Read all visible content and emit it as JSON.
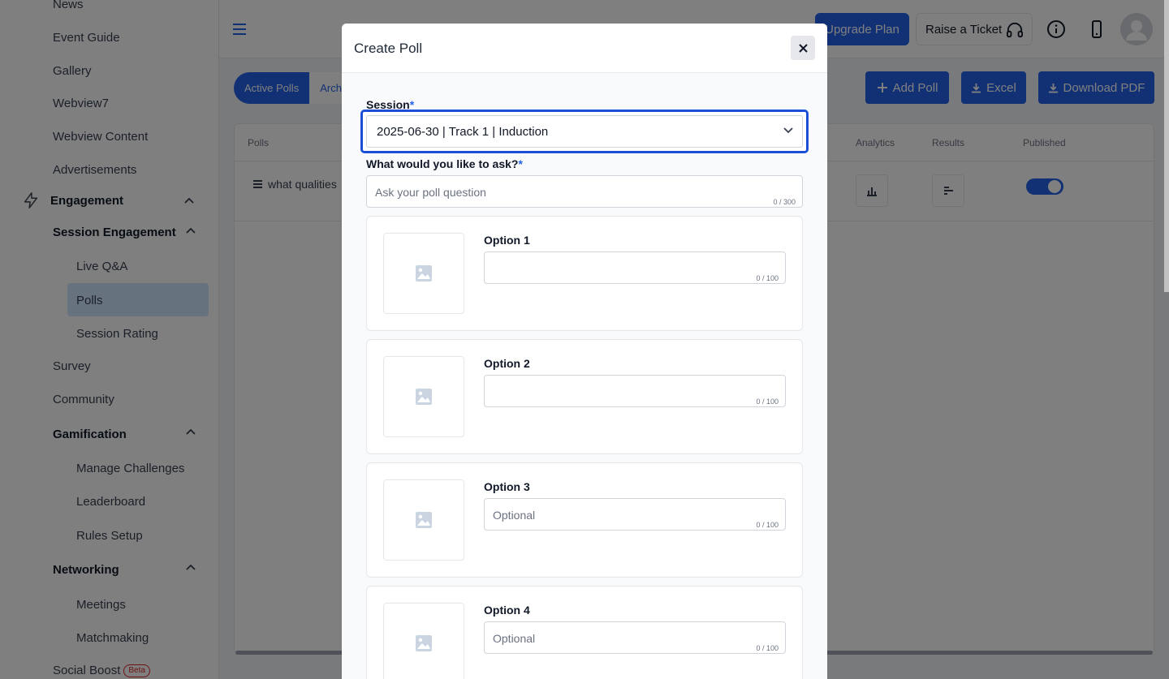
{
  "sidebar": {
    "items": [
      {
        "label": "News"
      },
      {
        "label": "Event Guide"
      },
      {
        "label": "Gallery"
      },
      {
        "label": "Webview7"
      },
      {
        "label": "Webview Content"
      },
      {
        "label": "Advertisements"
      },
      {
        "label": "Engagement"
      },
      {
        "label": "Session Engagement"
      },
      {
        "label": "Live Q&A"
      },
      {
        "label": "Polls"
      },
      {
        "label": "Session Rating"
      },
      {
        "label": "Survey"
      },
      {
        "label": "Community"
      },
      {
        "label": "Gamification"
      },
      {
        "label": "Manage Challenges"
      },
      {
        "label": "Leaderboard"
      },
      {
        "label": "Rules Setup"
      },
      {
        "label": "Networking"
      },
      {
        "label": "Meetings"
      },
      {
        "label": "Matchmaking"
      },
      {
        "label": "Social Boost"
      }
    ],
    "beta_label": "Beta"
  },
  "header": {
    "upgrade_label": "Upgrade Plan",
    "ticket_label": "Raise a Ticket"
  },
  "toolbar": {
    "tab_active": "Active Polls",
    "tab_archived": "Archi",
    "add_poll": "Add Poll",
    "excel": "Excel",
    "download_pdf": "Download PDF"
  },
  "table": {
    "headers": {
      "polls": "Polls",
      "analytics": "Analytics",
      "results": "Results",
      "published": "Published"
    },
    "rows": [
      {
        "question": "what qualities",
        "published": true
      }
    ]
  },
  "modal": {
    "title": "Create Poll",
    "session_label": "Session",
    "session_value": "2025-06-30 | Track 1 | Induction",
    "question_label": "What would you like to ask?",
    "question_placeholder": "Ask your poll question",
    "question_counter": "0 / 300",
    "required_mark": "*",
    "options": [
      {
        "label": "Option 1",
        "placeholder": "",
        "counter": "0 / 100"
      },
      {
        "label": "Option 2",
        "placeholder": "",
        "counter": "0 / 100"
      },
      {
        "label": "Option 3",
        "placeholder": "Optional",
        "counter": "0 / 100"
      },
      {
        "label": "Option 4",
        "placeholder": "Optional",
        "counter": "0 / 100"
      }
    ]
  },
  "colors": {
    "primary": "#2563eb",
    "active_nav": "#cfe5ff",
    "overlay": "rgba(0,0,0,0.5)"
  }
}
